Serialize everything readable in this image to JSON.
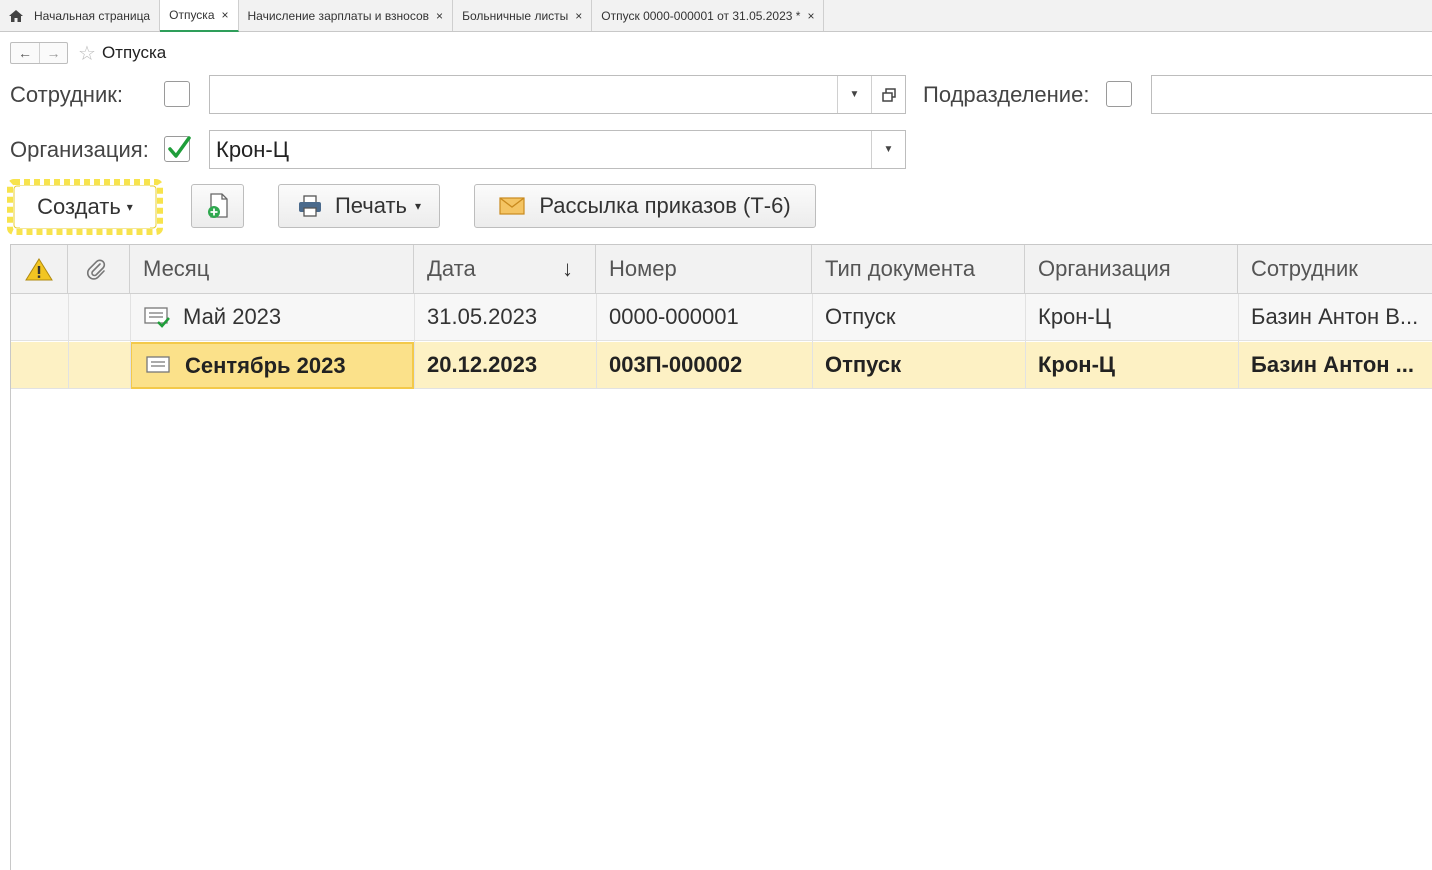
{
  "tabs": [
    {
      "label": "Начальная страница",
      "closable": false,
      "active": false
    },
    {
      "label": "Отпуска",
      "closable": true,
      "active": true
    },
    {
      "label": "Начисление зарплаты и взносов",
      "closable": true,
      "active": false
    },
    {
      "label": "Больничные листы",
      "closable": true,
      "active": false
    },
    {
      "label": "Отпуск 0000-000001 от 31.05.2023 *",
      "closable": true,
      "active": false
    }
  ],
  "tab_close_glyph": "×",
  "nav": {
    "back": "←",
    "forward": "→",
    "star": "☆",
    "title": "Отпуска"
  },
  "filters": {
    "employee_label": "Сотрудник:",
    "employee_value": "",
    "department_label": "Подразделение:",
    "department_value": "",
    "organization_label": "Организация:",
    "organization_value": "Крон-Ц",
    "organization_checked": true
  },
  "toolbar": {
    "create_label": "Создать",
    "print_label": "Печать",
    "mailing_label": "Рассылка приказов (Т-6)",
    "caret": "▾"
  },
  "table": {
    "columns": [
      "Месяц",
      "Дата",
      "Номер",
      "Тип документа",
      "Организация",
      "Сотрудник"
    ],
    "sort_glyph": "↓",
    "rows": [
      {
        "month": "Май 2023",
        "date": "31.05.2023",
        "number": "0000-000001",
        "type": "Отпуск",
        "org": "Крон-Ц",
        "employee": "Базин Антон В...",
        "posted": true
      },
      {
        "month": "Сентябрь 2023",
        "date": "20.12.2023",
        "number": "003П-000002",
        "type": "Отпуск",
        "org": "Крон-Ц",
        "employee": "Базин Антон ...",
        "posted": false
      }
    ]
  },
  "colors": {
    "accent_tab": "#2e9e5a",
    "selected_row": "#fdf1c4",
    "selected_cell": "#fbe18a",
    "highlight_burst": "#f7e34d"
  }
}
